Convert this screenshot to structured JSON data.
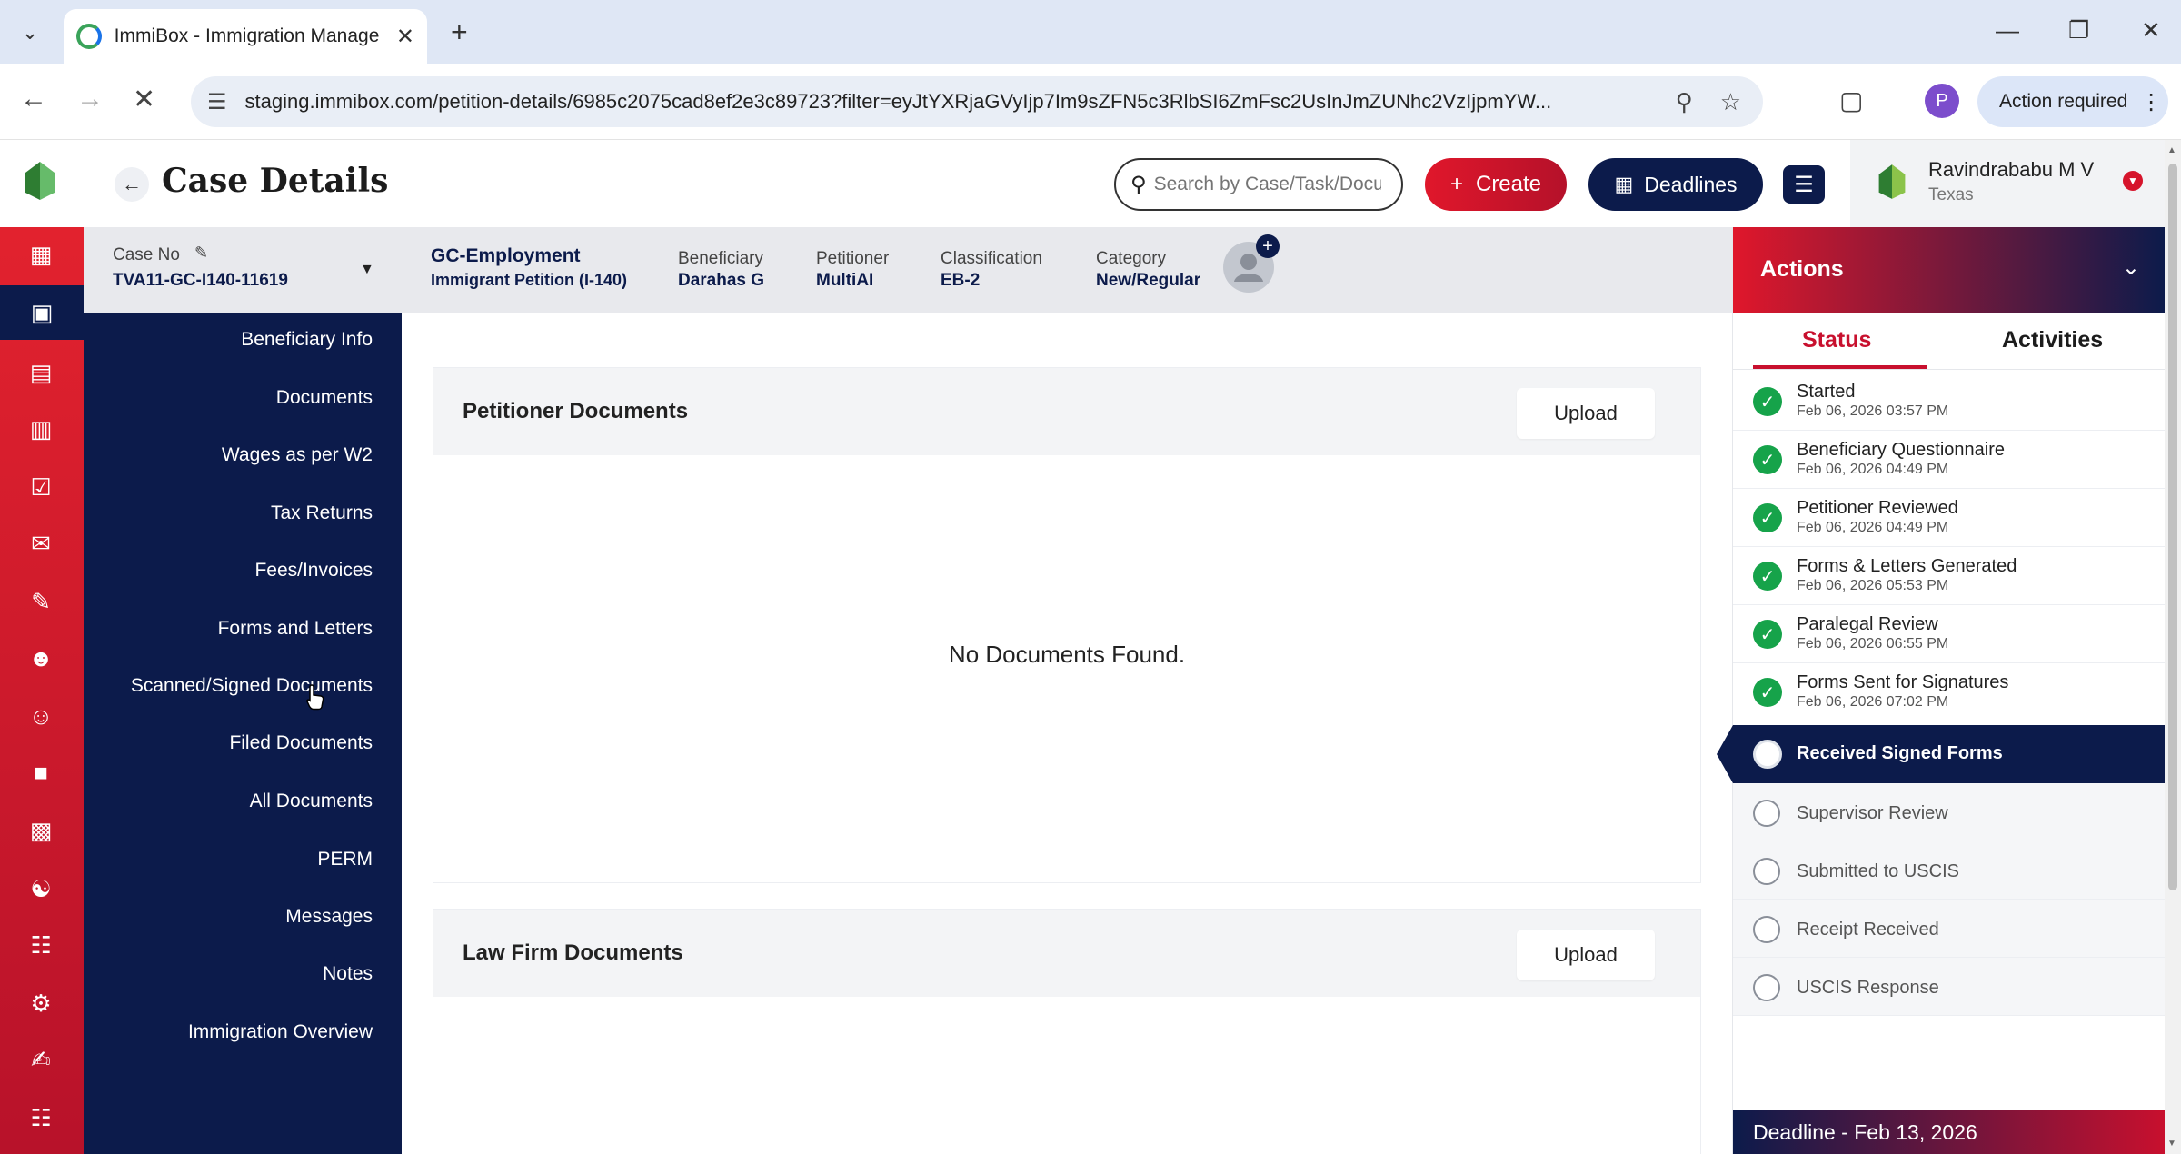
{
  "browser": {
    "tab_title": "ImmiBox - Immigration Manage",
    "url": "staging.immibox.com/petition-details/6985c2075cad8ef2e3c89723?filter=eyJtYXRjaGVyIjp7Im9sZFN5c3RlbSI6ZmFsc2UsInJmZUNhc2VzIjpmYW...",
    "profile_initial": "P",
    "action_required": "Action required"
  },
  "header": {
    "title": "Case Details",
    "search_placeholder": "Search by Case/Task/Document",
    "create_label": "Create",
    "deadlines_label": "Deadlines",
    "user_name": "Ravindrababu M V",
    "user_location": "Texas"
  },
  "case_bar": {
    "case_no_label": "Case No",
    "case_no": "TVA11-GC-I140-11619",
    "case_type": "GC-Employment",
    "case_subtype": "Immigrant Petition (I-140)",
    "beneficiary_label": "Beneficiary",
    "beneficiary": "Darahas G",
    "petitioner_label": "Petitioner",
    "petitioner": "MultiAI",
    "classification_label": "Classification",
    "classification": "EB-2",
    "category_label": "Category",
    "category": "New/Regular"
  },
  "section_nav": {
    "items": [
      "Beneficiary Info",
      "Documents",
      "Wages as per W2",
      "Tax Returns",
      "Fees/Invoices",
      "Forms and Letters",
      "Scanned/Signed Documents",
      "Filed Documents",
      "All Documents",
      "PERM",
      "Messages",
      "Notes",
      "Immigration Overview"
    ]
  },
  "main": {
    "petitioner_docs_title": "Petitioner Documents",
    "upload_label": "Upload",
    "empty_message": "No Documents Found.",
    "law_firm_docs_title": "Law Firm Documents"
  },
  "actions": {
    "title": "Actions",
    "tab_status": "Status",
    "tab_activities": "Activities",
    "steps": [
      {
        "name": "Started",
        "date": "Feb 06, 2026 03:57 PM"
      },
      {
        "name": "Beneficiary Questionnaire",
        "date": "Feb 06, 2026 04:49 PM"
      },
      {
        "name": "Petitioner Reviewed",
        "date": "Feb 06, 2026 04:49 PM"
      },
      {
        "name": "Forms & Letters Generated",
        "date": "Feb 06, 2026 05:53 PM"
      },
      {
        "name": "Paralegal Review",
        "date": "Feb 06, 2026 06:55 PM"
      },
      {
        "name": "Forms Sent for Signatures",
        "date": "Feb 06, 2026 07:02 PM"
      },
      {
        "name": "Received Signed Forms"
      },
      {
        "name": "Supervisor Review"
      },
      {
        "name": "Submitted to USCIS"
      },
      {
        "name": "Receipt Received"
      },
      {
        "name": "USCIS Response"
      }
    ],
    "deadline": "Deadline - Feb 13, 2026"
  },
  "colors": {
    "brand_red": "#e0172b",
    "brand_navy": "#0c1b4b",
    "success_green": "#16a34a"
  }
}
